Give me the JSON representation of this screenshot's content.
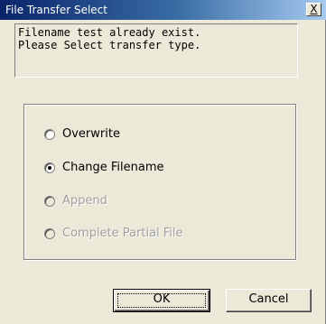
{
  "window": {
    "title": "File Transfer Select",
    "close_label": "X"
  },
  "message": {
    "line1": "Filename  test  already exist.",
    "line2": "Please Select transfer type."
  },
  "options": [
    {
      "label": "Overwrite",
      "selected": false,
      "enabled": true
    },
    {
      "label": "Change Filename",
      "selected": true,
      "enabled": true
    },
    {
      "label": "Append",
      "selected": false,
      "enabled": false
    },
    {
      "label": "Complete Partial File",
      "selected": false,
      "enabled": false
    }
  ],
  "buttons": {
    "ok_label": "OK",
    "cancel_label": "Cancel"
  }
}
